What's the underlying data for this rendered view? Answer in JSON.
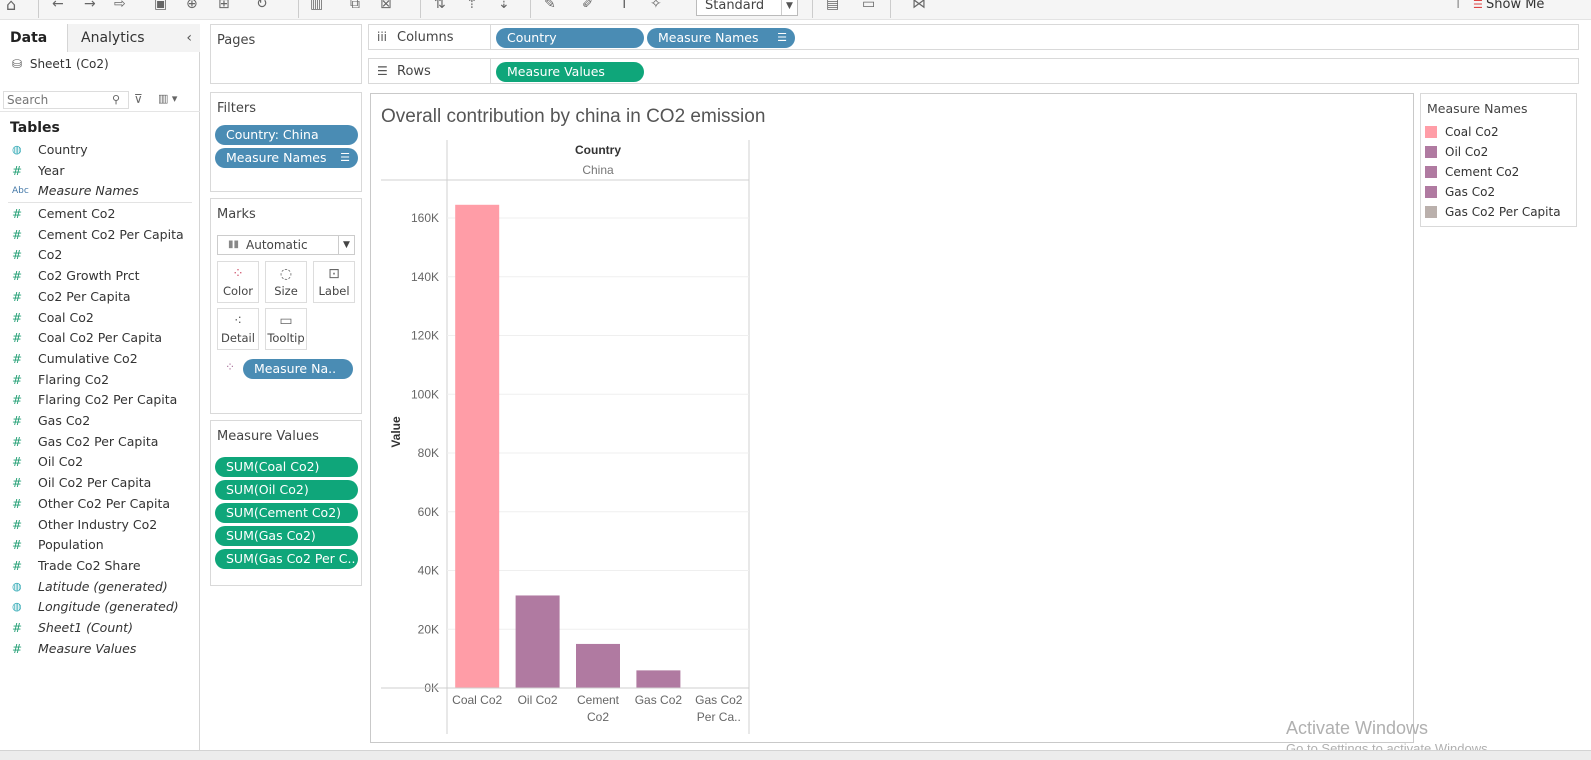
{
  "toolbar": {
    "standard_select": "Standard",
    "show_me": "Show Me"
  },
  "data_pane": {
    "tab_data": "Data",
    "tab_analytics": "Analytics",
    "datasource": "Sheet1 (Co2)",
    "search_placeholder": "Search",
    "tables_heading": "Tables",
    "dimensions": [
      {
        "name": "Country",
        "type": "geo",
        "italic": false
      },
      {
        "name": "Year",
        "type": "measure",
        "italic": false
      },
      {
        "name": "Measure Names",
        "type": "abc",
        "italic": true
      }
    ],
    "measures": [
      {
        "name": "Cement Co2",
        "type": "measure",
        "italic": false
      },
      {
        "name": "Cement Co2 Per Capita",
        "type": "measure",
        "italic": false
      },
      {
        "name": "Co2",
        "type": "measure",
        "italic": false
      },
      {
        "name": "Co2 Growth Prct",
        "type": "measure",
        "italic": false
      },
      {
        "name": "Co2 Per Capita",
        "type": "measure",
        "italic": false
      },
      {
        "name": "Coal Co2",
        "type": "measure",
        "italic": false
      },
      {
        "name": "Coal Co2 Per Capita",
        "type": "measure",
        "italic": false
      },
      {
        "name": "Cumulative Co2",
        "type": "measure",
        "italic": false
      },
      {
        "name": "Flaring Co2",
        "type": "measure",
        "italic": false
      },
      {
        "name": "Flaring Co2 Per Capita",
        "type": "measure",
        "italic": false
      },
      {
        "name": "Gas Co2",
        "type": "measure",
        "italic": false
      },
      {
        "name": "Gas Co2 Per Capita",
        "type": "measure",
        "italic": false
      },
      {
        "name": "Oil Co2",
        "type": "measure",
        "italic": false
      },
      {
        "name": "Oil Co2 Per Capita",
        "type": "measure",
        "italic": false
      },
      {
        "name": "Other Co2 Per Capita",
        "type": "measure",
        "italic": false
      },
      {
        "name": "Other Industry Co2",
        "type": "measure",
        "italic": false
      },
      {
        "name": "Population",
        "type": "measure",
        "italic": false
      },
      {
        "name": "Trade Co2 Share",
        "type": "measure",
        "italic": false
      },
      {
        "name": "Latitude (generated)",
        "type": "geo",
        "italic": true
      },
      {
        "name": "Longitude (generated)",
        "type": "geo",
        "italic": true
      },
      {
        "name": "Sheet1 (Count)",
        "type": "measure",
        "italic": true
      },
      {
        "name": "Measure Values",
        "type": "measure",
        "italic": true
      }
    ]
  },
  "pages": {
    "title": "Pages"
  },
  "filters": {
    "title": "Filters",
    "pills": [
      "Country: China",
      "Measure Names"
    ]
  },
  "marks": {
    "title": "Marks",
    "type": "Automatic",
    "cards": [
      "Color",
      "Size",
      "Label",
      "Detail",
      "Tooltip"
    ],
    "color_pill": "Measure Na.."
  },
  "measure_values": {
    "title": "Measure Values",
    "pills": [
      "SUM(Coal Co2)",
      "SUM(Oil Co2)",
      "SUM(Cement Co2)",
      "SUM(Gas Co2)",
      "SUM(Gas Co2 Per C.."
    ]
  },
  "columns": {
    "label": "Columns",
    "pills": [
      "Country",
      "Measure Names"
    ]
  },
  "rows": {
    "label": "Rows",
    "pills": [
      "Measure Values"
    ]
  },
  "view": {
    "title": "Overall contribution by china in CO2 emission",
    "column_header": "Country",
    "column_value": "China"
  },
  "chart_data": {
    "type": "bar",
    "title": "Overall contribution by china in CO2 emission",
    "xlabel": "",
    "ylabel": "Value",
    "categories": [
      "Coal Co2",
      "Oil Co2",
      "Cement Co2",
      "Gas Co2",
      "Gas Co2 Per Capita"
    ],
    "category_labels": [
      [
        "Coal Co2"
      ],
      [
        "Oil Co2"
      ],
      [
        "Cement",
        "Co2"
      ],
      [
        "Gas Co2"
      ],
      [
        "Gas Co2",
        "Per Ca.."
      ]
    ],
    "values": [
      164500,
      31500,
      15000,
      6000,
      0
    ],
    "colors": [
      "#ff9da7",
      "#b07aa1",
      "#b07aa1",
      "#b07aa1",
      "#bab0ac"
    ],
    "ylim": [
      0,
      160000
    ],
    "yticks": [
      0,
      20000,
      40000,
      60000,
      80000,
      100000,
      120000,
      140000,
      160000
    ],
    "ytick_labels": [
      "0K",
      "20K",
      "40K",
      "60K",
      "80K",
      "100K",
      "120K",
      "140K",
      "160K"
    ],
    "grid": true
  },
  "legend": {
    "title": "Measure Names",
    "items": [
      {
        "label": "Coal Co2",
        "color": "#ff9da7"
      },
      {
        "label": "Oil Co2",
        "color": "#b07aa1"
      },
      {
        "label": "Cement Co2",
        "color": "#b07aa1"
      },
      {
        "label": "Gas Co2",
        "color": "#b07aa1"
      },
      {
        "label": "Gas Co2 Per Capita",
        "color": "#bab0ac"
      }
    ]
  },
  "watermark": {
    "line1": "Activate Windows",
    "line2": "Go to Settings to activate Windows."
  }
}
